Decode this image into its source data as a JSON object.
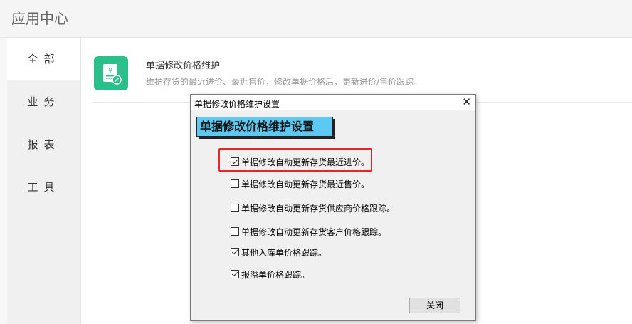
{
  "header": {
    "title": "应用中心"
  },
  "sidebar": {
    "items": [
      {
        "label": "全部"
      },
      {
        "label": "业务"
      },
      {
        "label": "报表"
      },
      {
        "label": "工具"
      }
    ]
  },
  "app": {
    "title": "单据修改价格维护",
    "description": "维护存货的最近进价、最近售价，修改单据价格后，更新进价/售价跟踪。"
  },
  "dialog": {
    "title": "单据修改价格维护设置",
    "banner": "单据修改价格维护设置",
    "options": [
      {
        "label": "单据修改自动更新存货最近进价。",
        "checked": true
      },
      {
        "label": "单据修改自动更新存货最近售价。",
        "checked": false
      },
      {
        "label": "单据修改自动更新存货供应商价格跟踪。",
        "checked": false
      },
      {
        "label": "单据修改自动更新存货客户价格跟踪。",
        "checked": false
      },
      {
        "label": "其他入库单价格跟踪。",
        "checked": true
      },
      {
        "label": "报溢单价格跟踪。",
        "checked": true
      }
    ],
    "close_button": "关闭"
  },
  "colors": {
    "accent_green": "#2bbf8c",
    "banner_blue": "#5bc9f2",
    "highlight_red": "#e5262d"
  }
}
